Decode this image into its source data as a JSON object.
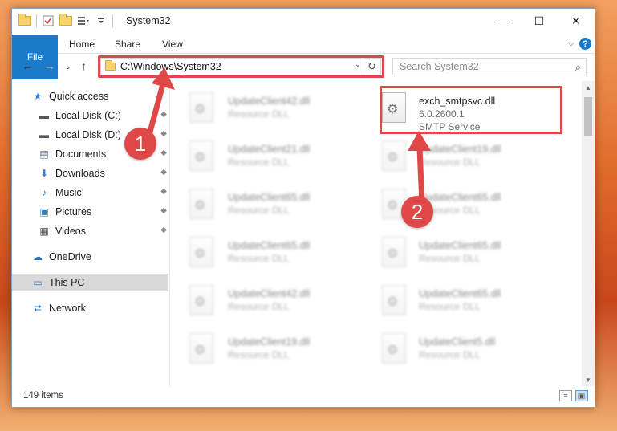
{
  "window": {
    "title": "System32",
    "controls": {
      "minimize": "—",
      "maximize": "☐",
      "close": "✕"
    }
  },
  "ribbon": {
    "tabs": [
      "File",
      "Home",
      "Share",
      "View"
    ],
    "help": "?",
    "collapse": "⌵"
  },
  "nav": {
    "back": "←",
    "forward": "→",
    "recent": "⌄",
    "up": "↑"
  },
  "address": {
    "path": "C:\\Windows\\System32",
    "dropdown": "⌄",
    "refresh": "↻"
  },
  "search": {
    "placeholder": "Search System32",
    "icon": "⌕"
  },
  "sidebar": {
    "items": [
      {
        "label": "Quick access",
        "icon": "star-icon",
        "glyph": "★",
        "pinned": false
      },
      {
        "label": "Local Disk (C:)",
        "icon": "drive-icon",
        "glyph": "▬",
        "pinned": true
      },
      {
        "label": "Local Disk (D:)",
        "icon": "drive-icon",
        "glyph": "▬",
        "pinned": true
      },
      {
        "label": "Documents",
        "icon": "documents-icon",
        "glyph": "▤",
        "pinned": true
      },
      {
        "label": "Downloads",
        "icon": "download-icon",
        "glyph": "⬇",
        "pinned": true
      },
      {
        "label": "Music",
        "icon": "music-icon",
        "glyph": "♪",
        "pinned": true
      },
      {
        "label": "Pictures",
        "icon": "pictures-icon",
        "glyph": "▣",
        "pinned": true
      },
      {
        "label": "Videos",
        "icon": "videos-icon",
        "glyph": "▦",
        "pinned": true
      },
      {
        "label": "OneDrive",
        "icon": "cloud-icon",
        "glyph": "☁",
        "pinned": false
      },
      {
        "label": "This PC",
        "icon": "computer-icon",
        "glyph": "▭",
        "pinned": false,
        "selected": true
      },
      {
        "label": "Network",
        "icon": "network-icon",
        "glyph": "⮂",
        "pinned": false
      }
    ],
    "pin_glyph": "◆"
  },
  "files": {
    "left_column": [
      {
        "name": "UpdateClient42.dll",
        "type": "Resource DLL"
      },
      {
        "name": "UpdateClient21.dll",
        "type": "Resource DLL"
      },
      {
        "name": "UpdateClient65.dll",
        "type": "Resource DLL"
      },
      {
        "name": "UpdateClient65.dll",
        "type": "Resource DLL"
      },
      {
        "name": "UpdateClient42.dll",
        "type": "Resource DLL"
      },
      {
        "name": "UpdateClient19.dll",
        "type": "Resource DLL"
      }
    ],
    "highlighted": {
      "name": "exch_smtpsvc.dll",
      "version": "6.0.2600.1",
      "description": "SMTP Service"
    },
    "right_column": [
      {
        "name": "UpdateClient19.dll",
        "type": "Resource DLL"
      },
      {
        "name": "UpdateClient65.dll",
        "type": "Resource DLL"
      },
      {
        "name": "UpdateClient65.dll",
        "type": "Resource DLL"
      },
      {
        "name": "UpdateClient65.dll",
        "type": "Resource DLL"
      },
      {
        "name": "UpdateClient5.dll",
        "type": "Resource DLL"
      }
    ],
    "gear_glyph": "⚙"
  },
  "status": {
    "count_text": "149 items"
  },
  "annotations": {
    "step1": "1",
    "step2": "2"
  },
  "colors": {
    "accent": "#1979ca",
    "highlight_red": "#e04848",
    "selected_bg": "#d9d9d9"
  }
}
